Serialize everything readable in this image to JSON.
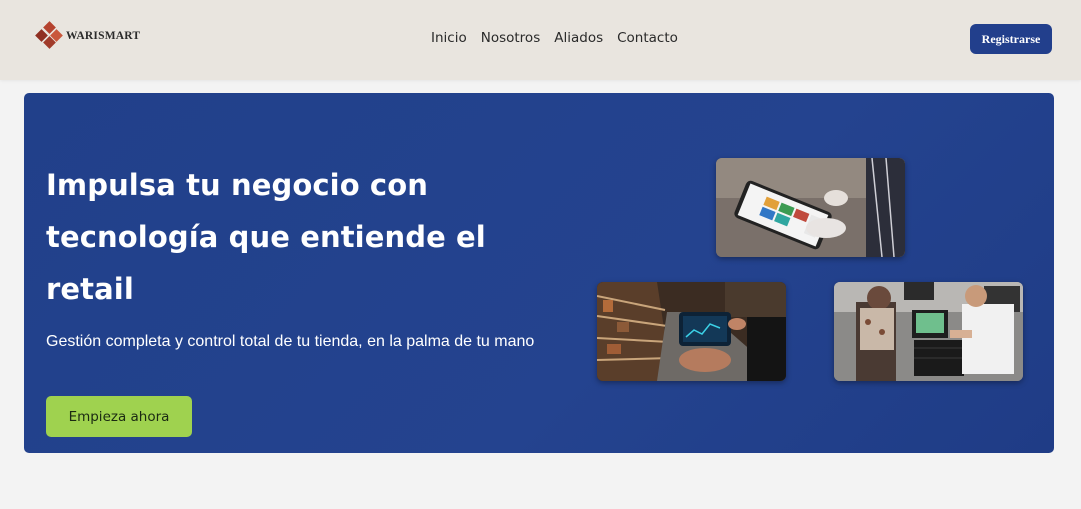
{
  "header": {
    "logo_text": "WARISMART",
    "logo_icon": "diamond-logo-icon",
    "nav": [
      "Inicio",
      "Nosotros",
      "Aliados",
      "Contacto"
    ],
    "register_label": "Registrarse"
  },
  "hero": {
    "title": "Impulsa tu negocio con tecnología que entiende el retail",
    "subtitle": "Gestión completa y control total de tu tienda, en la palma de tu mano",
    "cta_label": "Empieza ahora",
    "images": [
      "tablet-pos-photo",
      "warehouse-tablet-photo",
      "pos-station-photo"
    ]
  },
  "colors": {
    "header_bg": "#e9e5df",
    "hero_bg": "#22418c",
    "cta_bg": "#9fd24f",
    "register_bg": "#223f8c"
  }
}
